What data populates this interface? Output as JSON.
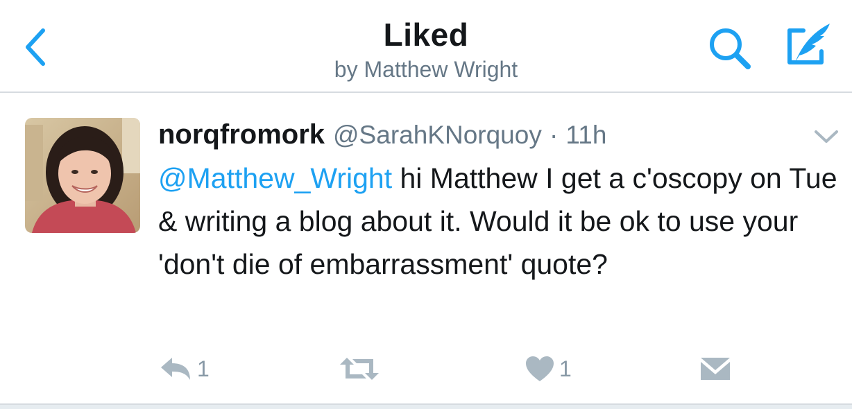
{
  "header": {
    "title": "Liked",
    "subtitle": "by Matthew Wright",
    "icons": {
      "back": "chevron-left-icon",
      "search": "search-icon",
      "compose": "compose-tweet-icon"
    }
  },
  "tweet": {
    "display_name": "norqfromork",
    "handle": "@SarahKNorquoy",
    "separator": "·",
    "time": "11h",
    "mention": "@Matthew_Wright",
    "text_after_mention": " hi Matthew I get a c'oscopy on Tue & writing a blog about it. Would it be ok to use your 'don't die of embarrassment' quote?",
    "actions": {
      "reply_count": "1",
      "retweet_count": "",
      "like_count": "1"
    }
  },
  "colors": {
    "accent": "#1da1f2",
    "text_primary": "#14171a",
    "text_secondary": "#657786",
    "icon_gray": "#aab8c2"
  }
}
